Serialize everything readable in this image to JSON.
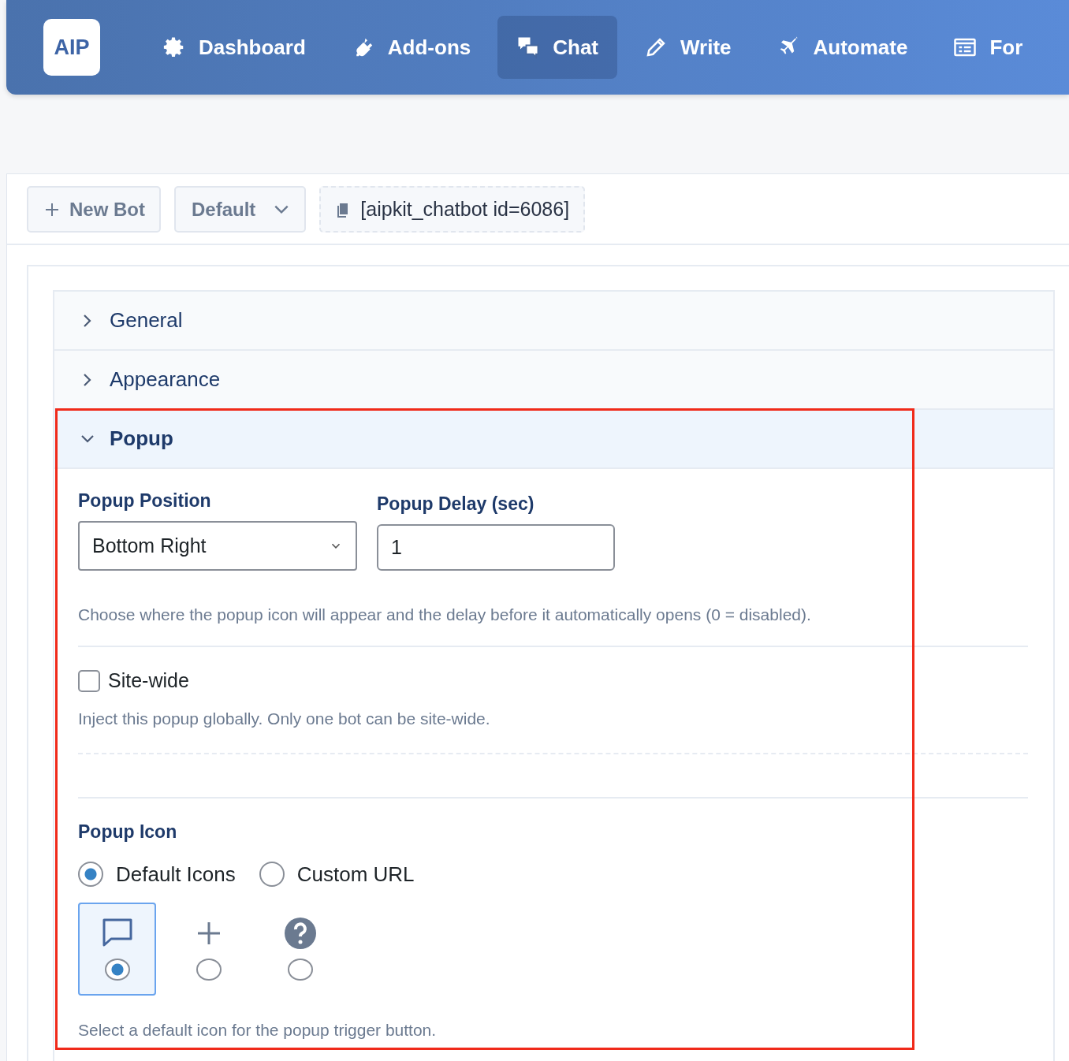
{
  "nav": {
    "logo": "AIP",
    "items": [
      {
        "label": "Dashboard",
        "kind": "gear",
        "selected": false
      },
      {
        "label": "Add-ons",
        "kind": "plug",
        "selected": false
      },
      {
        "label": "Chat",
        "kind": "chat",
        "selected": true
      },
      {
        "label": "Write",
        "kind": "pencil",
        "selected": false
      },
      {
        "label": "Automate",
        "kind": "plane",
        "selected": false
      },
      {
        "label": "For",
        "kind": "form",
        "selected": false
      }
    ]
  },
  "toolbar": {
    "new_bot_button": "New Bot",
    "bot_select": "Default",
    "shortcode": "[aipkit_chatbot id=6086]"
  },
  "sections": [
    {
      "title": "General",
      "expanded": false
    },
    {
      "title": "Appearance",
      "expanded": false
    },
    {
      "title": "Popup",
      "expanded": true
    }
  ],
  "popup": {
    "position": {
      "label": "Popup Position",
      "value": "Bottom Right"
    },
    "delay": {
      "label": "Popup Delay (sec)",
      "value": "1"
    },
    "help": "Choose where the popup icon will appear and the delay before it automatically opens (0 = disabled).",
    "site_wide": {
      "label": "Site-wide",
      "checked": false,
      "help": "Inject this popup globally. Only one bot can be site-wide."
    },
    "popup_icon": {
      "label": "Popup Icon",
      "source_options": [
        {
          "label": "Default Icons",
          "selected": true
        },
        {
          "label": "Custom URL",
          "selected": false
        }
      ],
      "icons": [
        {
          "kind": "chat",
          "selected": true
        },
        {
          "kind": "plus",
          "selected": false
        },
        {
          "kind": "question",
          "selected": false
        }
      ],
      "help": "Select a default icon for the popup trigger button."
    }
  }
}
